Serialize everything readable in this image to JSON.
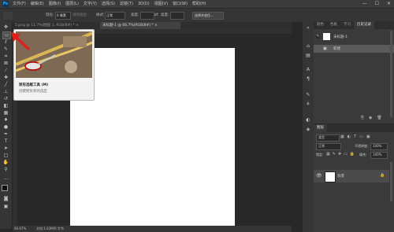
{
  "app": {
    "logo": "Ps",
    "window_controls": [
      "—",
      "☐",
      "✕"
    ]
  },
  "menubar": {
    "items": [
      "文件(F)",
      "编辑(E)",
      "图像(I)",
      "图层(L)",
      "文字(Y)",
      "选择(S)",
      "滤镜(T)",
      "3D(D)",
      "视图(V)",
      "窗口(W)",
      "帮助(H)"
    ]
  },
  "options_bar": {
    "feather_label": "羽化:",
    "feather_value": "0 像素",
    "antialias_label": "消除锯齿",
    "style_label": "样式:",
    "style_value": "正常",
    "width_label": "宽度:",
    "height_label": "高度:",
    "refine_label": "选择并遮住..."
  },
  "tabs": [
    {
      "label": "5.png @ 11.7%(图层 1, RGB/8#) *",
      "close": "×"
    },
    {
      "label": "未标题-1 @ 66.7%(RGB/8#) *",
      "close": "×"
    }
  ],
  "tooltip": {
    "title": "矩形选框工具 (M)",
    "description": "创建矩形状的选区"
  },
  "status": {
    "zoom": "66.67%",
    "doc_info": "文档:1.63M/0 字节"
  },
  "history_panel": {
    "tabs": [
      "颜色",
      "色板",
      "学习",
      "历史记录"
    ],
    "active_tab": "历史记录",
    "snapshot_label": "未标题-1",
    "states": [
      "新建"
    ]
  },
  "layers_panel": {
    "tabs": [
      "图层"
    ],
    "filter_label": "类型",
    "blend_mode": "正常",
    "opacity_label": "不透明度:",
    "opacity_value": "100%",
    "lock_label": "锁定:",
    "fill_label": "填充:",
    "fill_value": "100%",
    "layer_name": "背景",
    "layer_lock_icon": "lock-icon"
  },
  "colors": {
    "accent": "#31a8ff",
    "arrow": "#e0201a",
    "canvas": "#ffffff",
    "workspace": "#282828"
  }
}
